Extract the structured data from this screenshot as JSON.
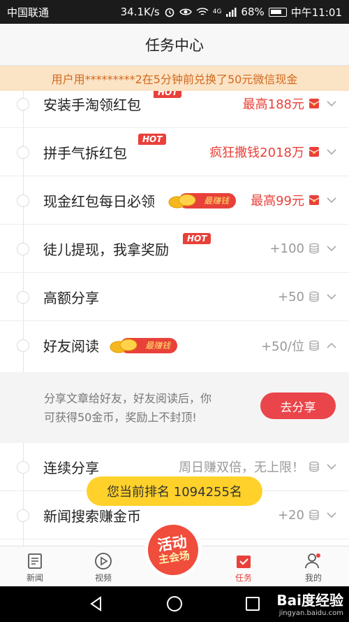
{
  "status_bar": {
    "carrier": "中国联通",
    "speed": "34.1K/s",
    "signal": "4G",
    "battery": "68%",
    "time": "中午11:01",
    "icons": [
      "alarm-icon",
      "eye-icon",
      "wifi-icon",
      "signal-icon",
      "battery-icon"
    ]
  },
  "header": {
    "title": "任务中心"
  },
  "notice": {
    "text": "用户用*********2在5分钟前兑换了50元微信现金"
  },
  "tasks": [
    {
      "name": "安装手淘领红包",
      "badge": "HOT",
      "reward": "最高188元",
      "reward_style": "red",
      "icon": "red-envelope-icon"
    },
    {
      "name": "拼手气拆红包",
      "badge": "HOT",
      "reward": "疯狂撒钱2018万",
      "reward_style": "red",
      "icon": "red-envelope-icon"
    },
    {
      "name": "现金红包每日必领",
      "badge": "最赚钱",
      "reward": "最高99元",
      "reward_style": "red",
      "icon": "red-envelope-icon"
    },
    {
      "name": "徒儿提现，我拿奖励",
      "badge": "HOT",
      "reward": "+100",
      "reward_style": "gray",
      "icon": "coin-stack-icon"
    },
    {
      "name": "高额分享",
      "badge": "",
      "reward": "+50",
      "reward_style": "gray",
      "icon": "coin-stack-icon"
    },
    {
      "name": "好友阅读",
      "badge": "最赚钱",
      "reward": "+50/位",
      "reward_style": "gray",
      "icon": "coin-stack-icon"
    },
    {
      "name": "连续分享",
      "badge": "",
      "reward": "周日赚双倍，无上限！",
      "reward_style": "gray",
      "icon": "coin-stack-icon"
    },
    {
      "name": "新闻搜索赚金币",
      "badge": "",
      "reward": "+20",
      "reward_style": "gray",
      "icon": "coin-stack-icon"
    }
  ],
  "expanded": {
    "line1": "分享文章给好友，好友阅读后，你",
    "line2": "可获得50金币，奖励上不封顶!",
    "button": "去分享"
  },
  "rank_banner": {
    "text": "您当前排名 1094255名"
  },
  "activity_badge": {
    "line1": "活动",
    "line2": "主会场"
  },
  "tabs": [
    {
      "label": "新闻",
      "icon": "news-icon",
      "active": false
    },
    {
      "label": "视频",
      "icon": "play-icon",
      "active": false
    },
    {
      "label": "任务",
      "icon": "task-icon",
      "active": true
    },
    {
      "label": "我的",
      "icon": "profile-icon",
      "active": false
    }
  ],
  "watermark": {
    "brand": "Bai度经验",
    "url": "jingyan.baidu.com"
  },
  "colors": {
    "accent": "#e8413a",
    "notice_bg": "#fbe3c5",
    "notice_text": "#d2691e",
    "rank_bg": "#ffd12a"
  }
}
